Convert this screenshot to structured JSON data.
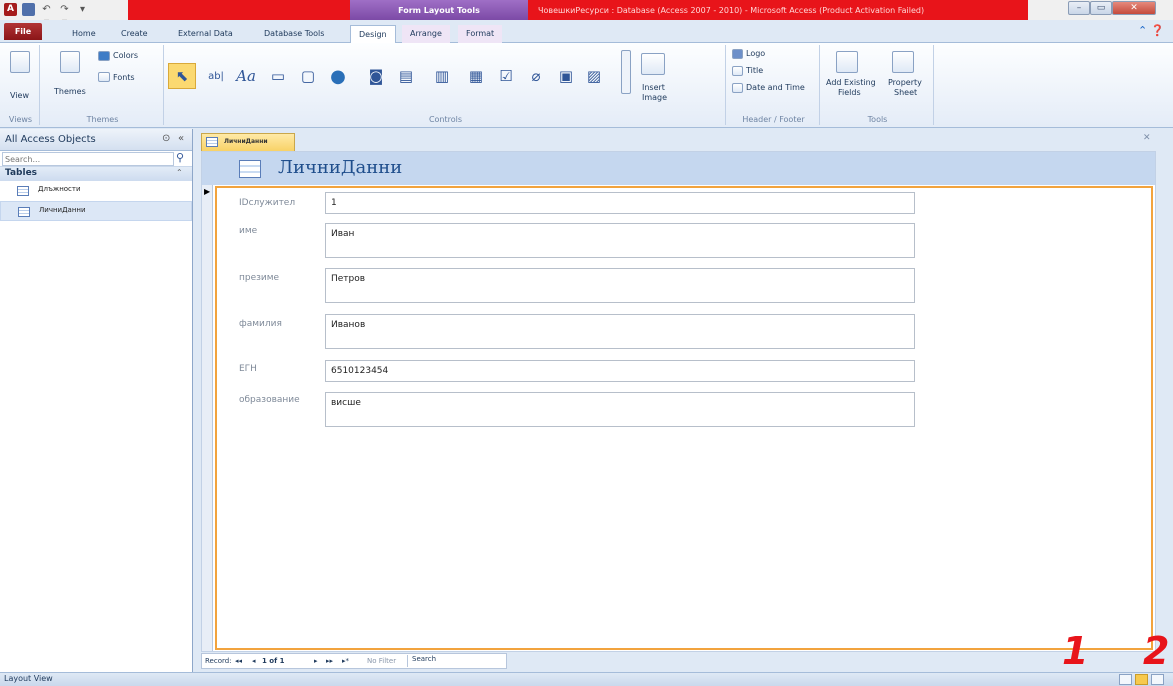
{
  "titlebar": {
    "contextual_tab_group": "Form Layout Tools",
    "window_title": "ЧовешкиРесурси : Database (Access 2007 - 2010) - Microsoft Access (Product Activation Failed)",
    "app_icon_letter": "A",
    "undo_label": "↶ ▾",
    "redo_label": "↷ ▾",
    "qat_dropdown_label": "▾",
    "minimize_label": "–",
    "maximize_label": "▭",
    "close_label": "✕"
  },
  "tabs": {
    "file": "File",
    "home": "Home",
    "create": "Create",
    "external_data": "External Data",
    "database_tools": "Database Tools",
    "design": "Design",
    "arrange": "Arrange",
    "format": "Format"
  },
  "ribbon": {
    "views": {
      "view": "View",
      "label": "Views"
    },
    "themes": {
      "themes": "Themes",
      "colors": "Colors",
      "fonts": "Fonts",
      "label": "Themes"
    },
    "controls": {
      "label": "Controls",
      "text_box_glyph": "ab|",
      "label_glyph": "Aa",
      "insert_image": "Insert",
      "insert_image_2": "Image"
    },
    "header_footer": {
      "logo": "Logo",
      "title": "Title",
      "date_time": "Date and Time",
      "label": "Header / Footer"
    },
    "tools": {
      "add_existing_1": "Add Existing",
      "add_existing_2": "Fields",
      "property_1": "Property",
      "property_2": "Sheet",
      "label": "Tools"
    }
  },
  "nav": {
    "title": "All Access Objects",
    "search_placeholder": "Search...",
    "section": "Tables",
    "items": [
      {
        "label": "Длъжности"
      },
      {
        "label": "ЛичниДанни"
      }
    ]
  },
  "document": {
    "tab_label": "ЛичниДанни",
    "form_title": "ЛичниДанни",
    "fields": [
      {
        "label": "IDслужител",
        "value": "1"
      },
      {
        "label": "име",
        "value": "Иван"
      },
      {
        "label": "презиме",
        "value": "Петров"
      },
      {
        "label": "фамилия",
        "value": "Иванов"
      },
      {
        "label": "ЕГН",
        "value": "6510123454"
      },
      {
        "label": "образование",
        "value": "висше"
      }
    ]
  },
  "record_nav": {
    "record_label": "Record:",
    "first": "◂◂",
    "prev": "◂",
    "position": "1 of 1",
    "next": "▸",
    "last": "▸▸",
    "new": "▸*",
    "filter": "No Filter",
    "search": "Search"
  },
  "status": {
    "text": "Layout View"
  },
  "annotations": {
    "one": "1",
    "two": "2"
  },
  "colors": {
    "title_red": "#e8141a",
    "contextual_purple": "#8c5ab8",
    "selection_orange": "#f2a33d",
    "header_blue": "#c5d7ef"
  }
}
